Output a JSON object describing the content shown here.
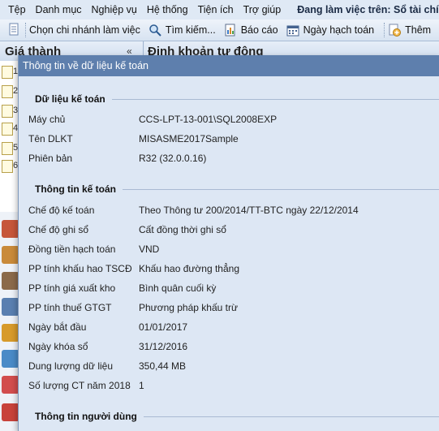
{
  "menu": {
    "items": [
      "Tệp",
      "Danh mục",
      "Nghiệp vụ",
      "Hệ thống",
      "Tiện ích",
      "Trợ giúp"
    ],
    "work_label": "Đang làm việc trên: Sổ tài chính"
  },
  "toolbar": {
    "branch": "Chọn chi nhánh làm việc",
    "search": "Tìm kiếm...",
    "report": "Báo cáo",
    "date": "Ngày hạch toán",
    "add": "Thêm"
  },
  "left_panel": {
    "title": "Giá thành",
    "collapse": "«",
    "nums": [
      "1",
      "2",
      "3",
      "4",
      "5",
      "6"
    ]
  },
  "right_panel": {
    "title": "Định khoản tự động"
  },
  "dialog": {
    "title": "Thông tin về dữ liệu kế toán",
    "group1": {
      "title": "Dữ liệu kế toán",
      "rows": [
        {
          "label": "Máy chủ",
          "value": "CCS-LPT-13-001\\SQL2008EXP"
        },
        {
          "label": "Tên DLKT",
          "value": "MISASME2017Sample"
        },
        {
          "label": "Phiên bản",
          "value": "R32 (32.0.0.16)"
        }
      ]
    },
    "group2": {
      "title": "Thông tin kế toán",
      "rows": [
        {
          "label": "Chế độ kế toán",
          "value": "Theo Thông tư 200/2014/TT-BTC ngày 22/12/2014"
        },
        {
          "label": "Chế độ ghi sổ",
          "value": "Cất đồng thời ghi sổ"
        },
        {
          "label": "Đồng tiền hạch toán",
          "value": "VND"
        },
        {
          "label": "PP tính khấu hao TSCĐ",
          "value": "Khấu hao đường thẳng"
        },
        {
          "label": "PP tính giá xuất kho",
          "value": "Bình quân cuối kỳ"
        },
        {
          "label": "PP tính thuế GTGT",
          "value": "Phương pháp khấu trừ"
        },
        {
          "label": "Ngày bắt đầu",
          "value": "01/01/2017"
        },
        {
          "label": "Ngày khóa sổ",
          "value": "31/12/2016"
        },
        {
          "label": "Dung lượng dữ liệu",
          "value": "350,44 MB"
        },
        {
          "label": "Số lượng CT năm 2018",
          "value": "1"
        }
      ]
    },
    "group3": {
      "title": "Thông tin người dùng"
    }
  }
}
